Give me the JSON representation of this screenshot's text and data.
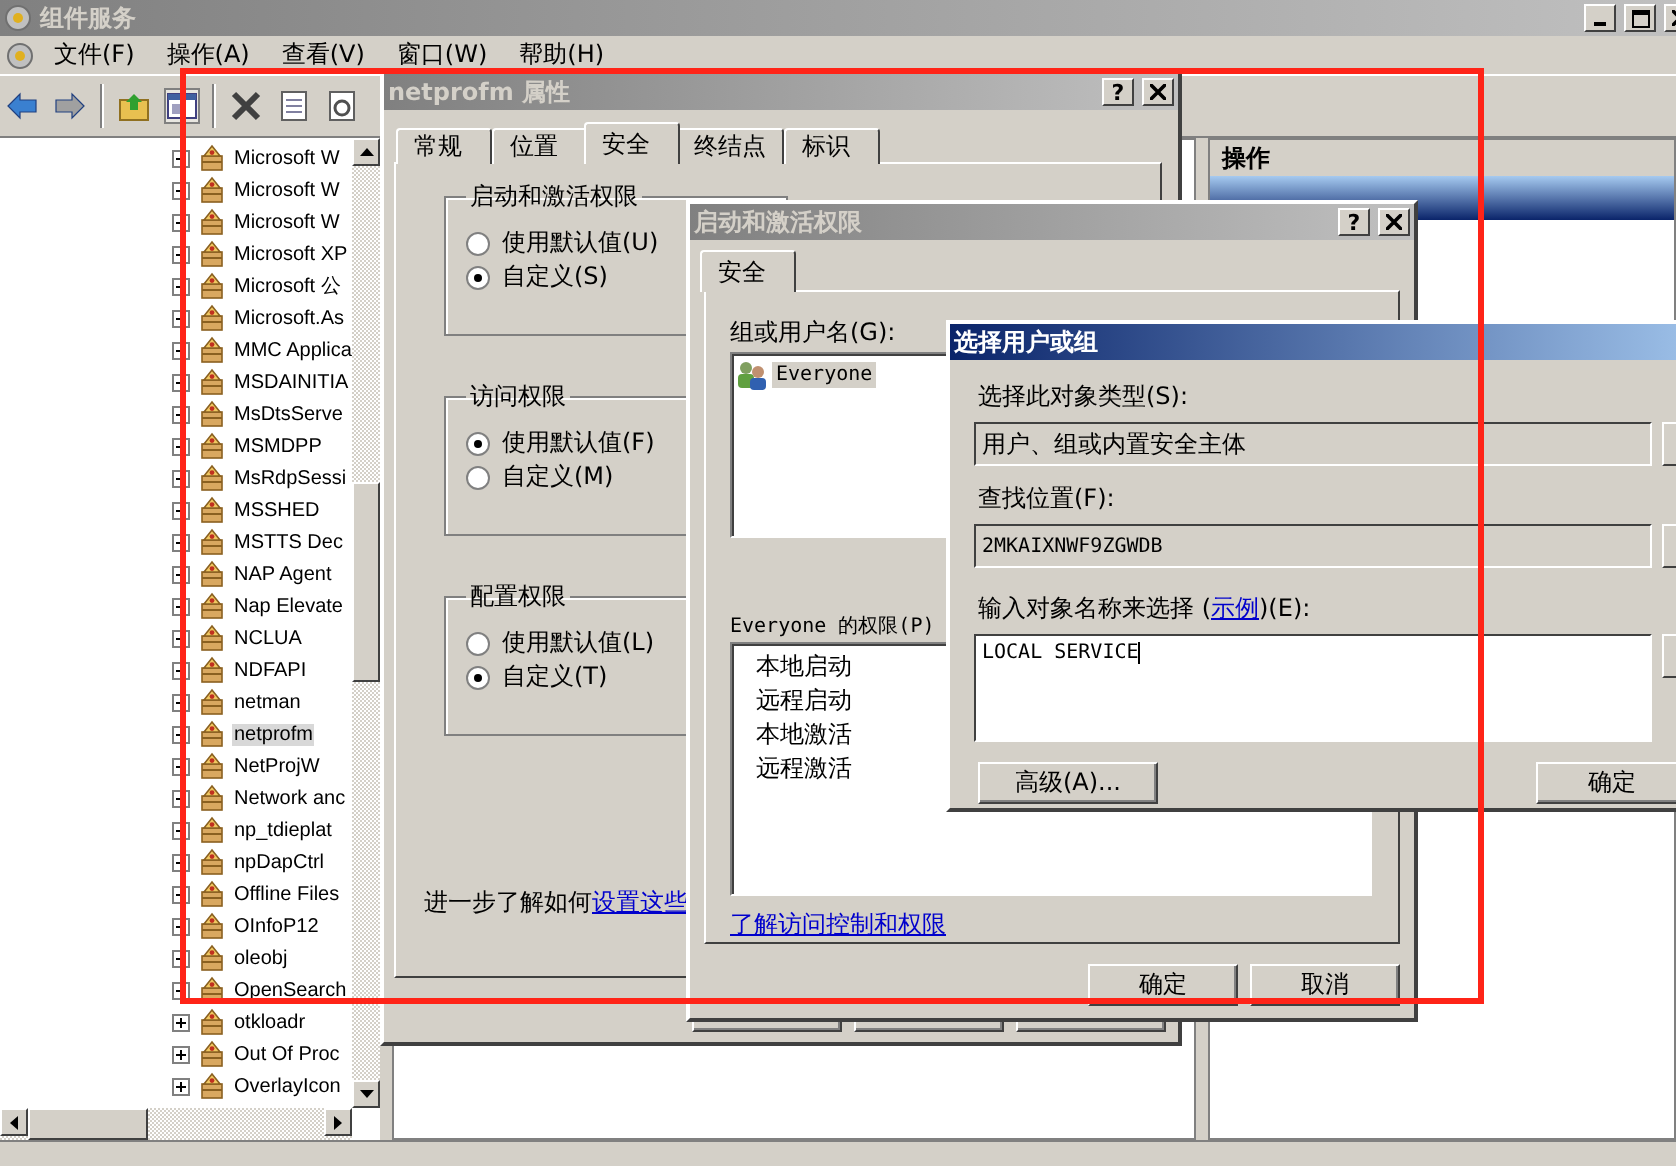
{
  "main_window": {
    "title": "组件服务",
    "menu": [
      "文件(F)",
      "操作(A)",
      "查看(V)",
      "窗口(W)",
      "帮助(H)"
    ],
    "tree": [
      {
        "label": "Microsoft W",
        "selected": false
      },
      {
        "label": "Microsoft W",
        "selected": false
      },
      {
        "label": "Microsoft W",
        "selected": false
      },
      {
        "label": "Microsoft XP",
        "selected": false
      },
      {
        "label": "Microsoft 公",
        "selected": false
      },
      {
        "label": "Microsoft.As",
        "selected": false
      },
      {
        "label": "MMC Applica",
        "selected": false
      },
      {
        "label": "MSDAINITIA",
        "selected": false
      },
      {
        "label": "MsDtsServe",
        "selected": false
      },
      {
        "label": "MSMDPP",
        "selected": false
      },
      {
        "label": "MsRdpSessi",
        "selected": false
      },
      {
        "label": "MSSHED",
        "selected": false
      },
      {
        "label": "MSTTS Dec",
        "selected": false
      },
      {
        "label": "NAP Agent",
        "selected": false
      },
      {
        "label": "Nap Elevate",
        "selected": false
      },
      {
        "label": "NCLUA",
        "selected": false
      },
      {
        "label": "NDFAPI",
        "selected": false
      },
      {
        "label": "netman",
        "selected": false
      },
      {
        "label": "netprofm",
        "selected": true
      },
      {
        "label": "NetProjW",
        "selected": false
      },
      {
        "label": "Network anc",
        "selected": false
      },
      {
        "label": "np_tdieplat",
        "selected": false
      },
      {
        "label": "npDapCtrl",
        "selected": false
      },
      {
        "label": "Offline Files",
        "selected": false
      },
      {
        "label": "OInfoP12",
        "selected": false
      },
      {
        "label": "oleobj",
        "selected": false
      },
      {
        "label": "OpenSearch",
        "selected": false
      },
      {
        "label": "otkloadr",
        "selected": false
      },
      {
        "label": "Out Of Proc",
        "selected": false
      },
      {
        "label": "OverlayIcon",
        "selected": false
      }
    ],
    "actions_pane": {
      "header": "操作"
    }
  },
  "properties_dialog": {
    "title": "netprofm 属性",
    "help_button": "?",
    "tabs": [
      {
        "label": "常规",
        "selected": false
      },
      {
        "label": "位置",
        "selected": false
      },
      {
        "label": "安全",
        "selected": true
      },
      {
        "label": "终结点",
        "selected": false
      },
      {
        "label": "标识",
        "selected": false
      }
    ],
    "groups": [
      {
        "title": "启动和激活权限",
        "options": [
          {
            "label": "使用默认值(U)",
            "selected": false
          },
          {
            "label": "自定义(S)",
            "selected": true
          }
        ]
      },
      {
        "title": "访问权限",
        "options": [
          {
            "label": "使用默认值(F)",
            "selected": true
          },
          {
            "label": "自定义(M)",
            "selected": false
          }
        ]
      },
      {
        "title": "配置权限",
        "options": [
          {
            "label": "使用默认值(L)",
            "selected": false
          },
          {
            "label": "自定义(T)",
            "selected": true
          }
        ]
      }
    ],
    "help_text": "进一步了解如何",
    "help_link": "设置这些"
  },
  "permissions_dialog": {
    "title": "启动和激活权限",
    "help_button": "?",
    "tabs": [
      {
        "label": "安全",
        "selected": true
      }
    ],
    "users_label": "组或用户名(G):",
    "users": [
      {
        "label": "Everyone",
        "selected": true
      }
    ],
    "permissions_label": "Everyone 的权限(P)",
    "permissions": [
      "本地启动",
      "远程启动",
      "本地激活",
      "远程激活"
    ],
    "link": "了解访问控制和权限",
    "buttons": [
      "确定",
      "取消"
    ]
  },
  "select_dialog": {
    "title": "选择用户或组",
    "object_type_label": "选择此对象类型(S):",
    "object_type": "用户、组或内置安全主体",
    "location_label": "查找位置(F):",
    "location": "2MKAIXNWF9ZGWDB",
    "names_label_before": "输入对象名称来选择 (",
    "names_label_link": "示例",
    "names_label_after": ")(E):",
    "names_value": "LOCAL SERVICE",
    "advanced_button": "高级(A)...",
    "ok_button": "确定"
  }
}
